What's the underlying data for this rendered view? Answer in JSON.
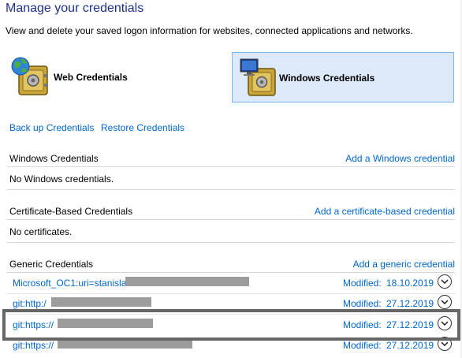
{
  "page": {
    "title": "Manage your credentials",
    "subtitle": "View and delete your saved logon information for websites, connected applications and networks."
  },
  "tiles": {
    "web": {
      "label": "Web Credentials",
      "icon": "globe-vault-icon"
    },
    "windows": {
      "label": "Windows Credentials",
      "icon": "monitor-vault-icon",
      "selected": true
    }
  },
  "links": {
    "backup": "Back up Credentials",
    "restore": "Restore Credentials"
  },
  "sections": {
    "windows": {
      "title": "Windows Credentials",
      "action": "Add a Windows credential",
      "empty": "No Windows credentials."
    },
    "certificate": {
      "title": "Certificate-Based Credentials",
      "action": "Add a certificate-based credential",
      "empty": "No certificates."
    },
    "generic": {
      "title": "Generic Credentials",
      "action": "Add a generic credential"
    }
  },
  "generic_rows": [
    {
      "name": "Microsoft_OC1:uri=stanislav",
      "modified_label": "Modified:",
      "modified_date": "18.10.2019"
    },
    {
      "name": "git:http:/",
      "modified_label": "Modified:",
      "modified_date": "27.12.2019"
    },
    {
      "name": "git:https://",
      "modified_label": "Modified:",
      "modified_date": "27.12.2019"
    },
    {
      "name": "git:https://",
      "modified_label": "Modified:",
      "modified_date": "27.12.2019"
    }
  ],
  "colors": {
    "title": "#1e3287",
    "link": "#0066cc",
    "selected_tile_bg": "#dbe9f9",
    "selected_tile_border": "#7eb4ea",
    "highlight": "#666666"
  }
}
